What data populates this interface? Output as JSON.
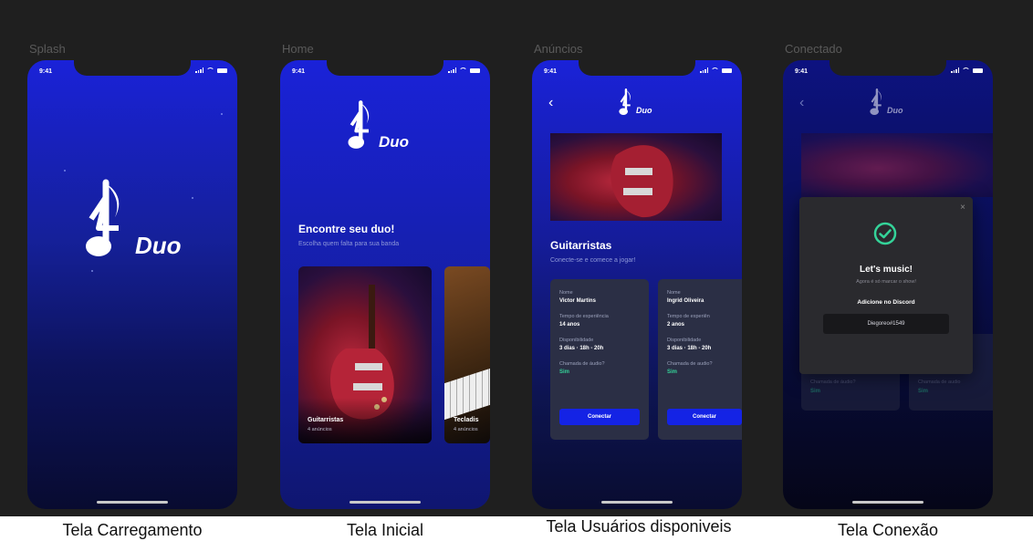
{
  "frames": [
    {
      "label": "Splash",
      "caption": "Tela Carregamento"
    },
    {
      "label": "Home",
      "caption": "Tela Inicial"
    },
    {
      "label": "Anúncios",
      "caption": "Tela Usuários disponiveis"
    },
    {
      "label": "Conectado",
      "caption": "Tela Conexão"
    }
  ],
  "status_time": "9:41",
  "logo_text": "Duo",
  "home": {
    "title": "Encontre seu duo!",
    "subtitle": "Escolha quem falta para sua banda",
    "cards": [
      {
        "title": "Guitarristas",
        "count": "4 anúncios"
      },
      {
        "title": "Tecladis",
        "count": "4 anúncios"
      }
    ]
  },
  "ads": {
    "title": "Guitarristas",
    "subtitle": "Conecte-se e comece a jogar!",
    "labels": {
      "name": "Nome",
      "experience": "Tempo de experiência",
      "experience_short": "Tempo de experiên",
      "availability": "Disponibilidade",
      "audio": "Chamada de áudio?",
      "audio_short": "Chamada de audio?"
    },
    "users": [
      {
        "name": "Victor Martins",
        "experience": "14 anos",
        "availability": "3 dias · 18h - 20h",
        "audio": "Sim",
        "button": "Conectar"
      },
      {
        "name": "Ingrid Oliveira",
        "experience": "2 anos",
        "availability": "3 dias · 18h - 20h",
        "audio": "Sim",
        "button": "Conectar"
      }
    ]
  },
  "connected": {
    "title": "Let's music!",
    "subtitle": "Agora é só marcar o show!",
    "discord_label": "Adicione no Discord",
    "discord_user": "Diegoreo#1549",
    "bg_label_audio": "Chamada de áudio?",
    "bg_label_audio_short": "Chamada de audio",
    "bg_audio_value": "Sim"
  },
  "colors": {
    "board": "#1f1f1f",
    "accent_blue": "#1423e5",
    "success_green": "#34d399",
    "card_bg": "#2b2f45"
  },
  "icons": [
    "back-arrow-icon",
    "check-circle-icon",
    "close-icon",
    "note-logo-icon"
  ]
}
